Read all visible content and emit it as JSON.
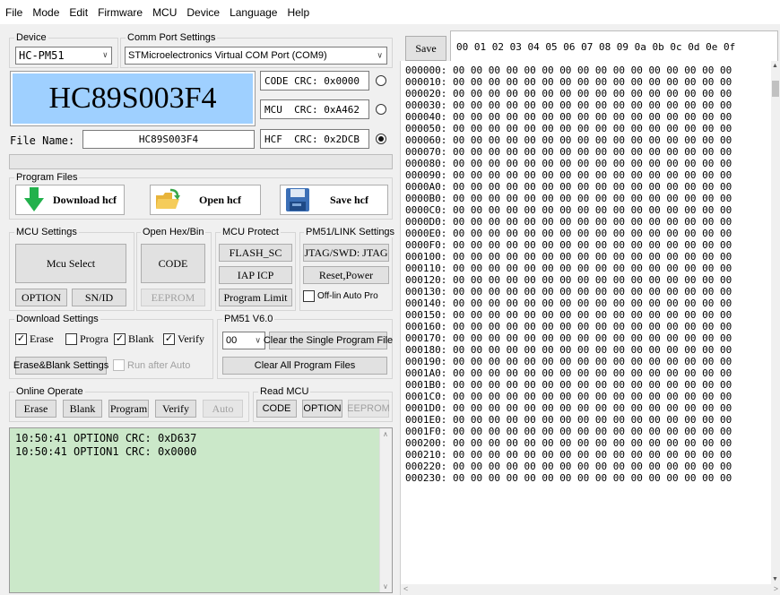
{
  "menu": [
    "File",
    "Mode",
    "Edit",
    "Firmware",
    "MCU",
    "Device",
    "Language",
    "Help"
  ],
  "device": {
    "label": "Device",
    "value": "HC-PM51"
  },
  "comm_port": {
    "label": "Comm Port Settings",
    "value": "STMicroelectronics Virtual COM Port (COM9)"
  },
  "chip_name": "HC89S003F4",
  "crc": {
    "code": "CODE CRC: 0x0000",
    "mcu": "MCU  CRC: 0xA462",
    "hcf": "HCF  CRC: 0x2DCB",
    "selected": "hcf"
  },
  "file_name": {
    "label": "File Name:",
    "value": "HC89S003F4"
  },
  "program_files": {
    "label": "Program Files",
    "download": "Download hcf",
    "open": "Open hcf",
    "save": "Save hcf"
  },
  "mcu_settings": {
    "label": "MCU Settings",
    "select": "Mcu Select",
    "option": "OPTION",
    "snid": "SN/ID"
  },
  "open_hex": {
    "label": "Open Hex/Bin",
    "code": "CODE",
    "eeprom": "EEPROM"
  },
  "mcu_protect": {
    "label": "MCU Protect",
    "flash_sc": "FLASH_SC",
    "iap_icp": "IAP ICP",
    "program_limit": "Program Limit"
  },
  "pm51_link": {
    "label": "PM51/LINK Settings",
    "jtag": "JTAG/SWD: JTAG",
    "reset": "Reset,Power",
    "offline": "Off-lin Auto Pro"
  },
  "download_settings": {
    "label": "Download Settings",
    "erase": "Erase",
    "program": "Progra",
    "blank": "Blank",
    "verify": "Verify",
    "erase_blank_settings": "Erase&Blank Settings",
    "run_after_auto": "Run after Auto"
  },
  "pm51_v6": {
    "label": "PM51 V6.0",
    "slot": "00",
    "clear_single": "Clear the Single Program File",
    "clear_all": "Clear All Program Files"
  },
  "online_operate": {
    "label": "Online Operate",
    "erase": "Erase",
    "blank": "Blank",
    "program": "Program",
    "verify": "Verify",
    "auto": "Auto"
  },
  "read_mcu": {
    "label": "Read MCU",
    "code": "CODE",
    "option": "OPTION",
    "eeprom": "EEPROM"
  },
  "log": [
    "10:50:41 OPTION0 CRC: 0xD637",
    "10:50:41 OPTION1 CRC: 0x0000"
  ],
  "hex": {
    "save": "Save",
    "header": "00 01 02 03 04 05 06 07 08 09 0a 0b 0c 0d 0e 0f",
    "rows": [
      "000000:",
      "000010:",
      "000020:",
      "000030:",
      "000040:",
      "000050:",
      "000060:",
      "000070:",
      "000080:",
      "000090:",
      "0000A0:",
      "0000B0:",
      "0000C0:",
      "0000D0:",
      "0000E0:",
      "0000F0:",
      "000100:",
      "000110:",
      "000120:",
      "000130:",
      "000140:",
      "000150:",
      "000160:",
      "000170:",
      "000180:",
      "000190:",
      "0001A0:",
      "0001B0:",
      "0001C0:",
      "0001D0:",
      "0001E0:",
      "0001F0:",
      "000200:",
      "000210:",
      "000220:",
      "000230:"
    ],
    "fill": "00 00 00 00 00 00 00 00 00 00 00 00 00 00 00 00"
  },
  "colors": {
    "chip_bg": "#9fd0ff",
    "log_bg": "#cbe8c9",
    "download_arrow": "#22b14c"
  }
}
